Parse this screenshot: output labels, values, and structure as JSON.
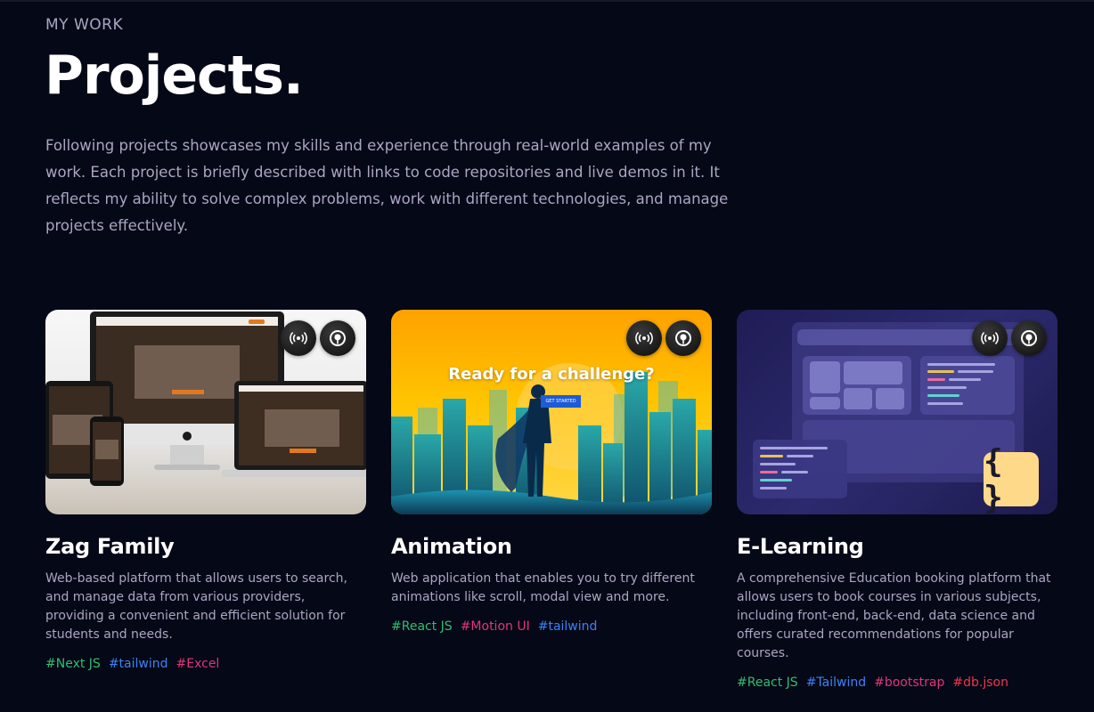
{
  "header": {
    "subtitle": "MY WORK",
    "title": "Projects.",
    "intro": "Following projects showcases my skills and experience through real-world examples of my work. Each project is briefly described with links to code repositories and live demos in it. It reflects my ability to solve complex problems, work with different technologies, and manage projects effectively."
  },
  "projects": [
    {
      "name": "Zag Family",
      "description": "Web-based platform that allows users to search, and manage data from various providers, providing a convenient and efficient solution for students and needs.",
      "tags": [
        {
          "label": "#Next JS",
          "color": "#2fbf71"
        },
        {
          "label": "#tailwind",
          "color": "#3b82f6"
        },
        {
          "label": "#Excel",
          "color": "#e0367a"
        }
      ]
    },
    {
      "name": "Animation",
      "description": "Web application that enables you to try different animations like scroll, modal view and more.",
      "image_text": {
        "headline": "Ready for a challenge?",
        "button": "GET STARTED"
      },
      "tags": [
        {
          "label": "#React JS",
          "color": "#2fbf71"
        },
        {
          "label": "#Motion UI",
          "color": "#e0367a"
        },
        {
          "label": "#tailwind",
          "color": "#3b82f6"
        }
      ]
    },
    {
      "name": "E-Learning",
      "description": "A comprehensive Education booking platform that allows users to book courses in various subjects, including front-end, back-end, data science and offers curated recommendations for popular courses.",
      "image_text": {
        "badge": "{ }"
      },
      "tags": [
        {
          "label": "#React JS",
          "color": "#2fbf71"
        },
        {
          "label": "#Tailwind",
          "color": "#3b82f6"
        },
        {
          "label": "#bootstrap",
          "color": "#e0367a"
        },
        {
          "label": "#db.json",
          "color": "#f0364e"
        }
      ]
    }
  ],
  "icons": {
    "live_demo": "broadcast-icon",
    "source_code": "github-icon"
  },
  "colors": {
    "background": "#050816",
    "secondary_text": "#aaa6c3"
  }
}
